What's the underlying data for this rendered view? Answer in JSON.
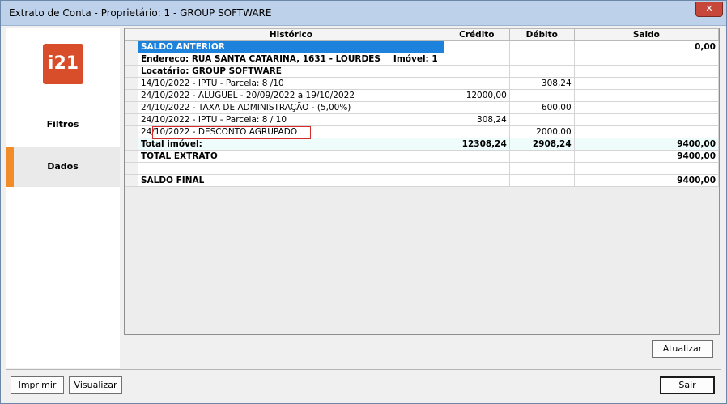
{
  "window": {
    "title": "Extrato de Conta - Proprietário:  1 - GROUP SOFTWARE",
    "close_label": "✕"
  },
  "sidebar": {
    "logo_text": "i21",
    "items": [
      {
        "label": "Filtros",
        "selected": false
      },
      {
        "label": "Dados",
        "selected": true
      }
    ],
    "accent_color": "#f28c28"
  },
  "grid": {
    "columns": [
      "Histórico",
      "Crédito",
      "Débito",
      "Saldo"
    ],
    "rows": [
      {
        "historico": "SALDO ANTERIOR",
        "credito": "",
        "debito": "",
        "saldo": "0,00",
        "style": "selected"
      },
      {
        "historico": "Endereco: RUA SANTA CATARINA, 1631 - LOURDES",
        "extra_label": "Imóvel: 1",
        "credito": "",
        "debito": "",
        "saldo": "",
        "style": "indent-1"
      },
      {
        "historico": "Locatário: GROUP SOFTWARE",
        "credito": "",
        "debito": "",
        "saldo": "",
        "style": "indent-1"
      },
      {
        "historico": "14/10/2022 - IPTU - Parcela: 8 /10",
        "credito": "",
        "debito": "308,24",
        "saldo": "",
        "style": "indent-2"
      },
      {
        "historico": "24/10/2022 - ALUGUEL - 20/09/2022 à 19/10/2022",
        "credito": "12000,00",
        "debito": "",
        "saldo": "",
        "style": "indent-2"
      },
      {
        "historico": "24/10/2022 - TAXA DE ADMINISTRAÇÃO - (5,00%)",
        "credito": "",
        "debito": "600,00",
        "saldo": "",
        "style": "indent-2"
      },
      {
        "historico": "24/10/2022 - IPTU - Parcela: 8  / 10",
        "credito": "308,24",
        "debito": "",
        "saldo": "",
        "style": "indent-2"
      },
      {
        "historico": "24/10/2022 - DESCONTO  AGRUPADO",
        "credito": "",
        "debito": "2000,00",
        "saldo": "",
        "style": "indent-2"
      },
      {
        "historico": "Total imóvel:",
        "credito": "12308,24",
        "debito": "2908,24",
        "saldo": "9400,00",
        "style": "total-imovel"
      },
      {
        "historico": "TOTAL EXTRATO",
        "credito": "",
        "debito": "",
        "saldo": "9400,00",
        "style": "bold"
      },
      {
        "historico": "",
        "credito": "",
        "debito": "",
        "saldo": "",
        "style": "blank"
      },
      {
        "historico": "SALDO FINAL",
        "credito": "",
        "debito": "",
        "saldo": "9400,00",
        "style": "bold"
      }
    ]
  },
  "buttons": {
    "atualizar": "Atualizar",
    "imprimir": "Imprimir",
    "visualizar": "Visualizar",
    "sair": "Sair"
  }
}
